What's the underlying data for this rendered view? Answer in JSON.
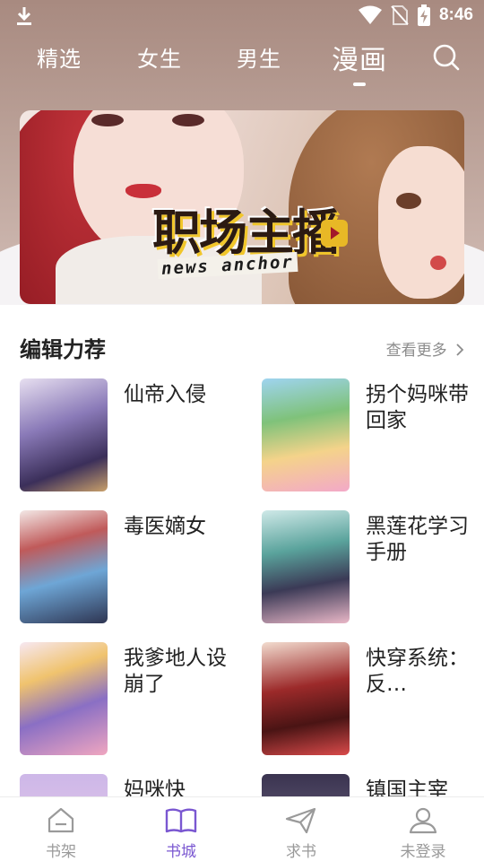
{
  "status_bar": {
    "time": "8:46",
    "icons": [
      "download-icon",
      "wifi-icon",
      "no-sim-icon",
      "battery-charging-icon"
    ]
  },
  "tabs": [
    {
      "label": "精选",
      "active": false
    },
    {
      "label": "女生",
      "active": false
    },
    {
      "label": "男生",
      "active": false
    },
    {
      "label": "漫画",
      "active": true
    }
  ],
  "search_icon": "search-icon",
  "banner": {
    "title_cn": "职场主播",
    "title_en": "news anchor"
  },
  "editor_picks": {
    "title": "编辑力荐",
    "more_label": "查看更多",
    "more_icon": "chevron-right-icon",
    "books": [
      {
        "title": "仙帝入侵"
      },
      {
        "title": "拐个妈咪带回家"
      },
      {
        "title": "毒医嫡女"
      },
      {
        "title": "黑莲花学习手册"
      },
      {
        "title": "我爹地人设崩了"
      },
      {
        "title": "快穿系统：反…"
      },
      {
        "title": "妈咪快"
      },
      {
        "title": "镇国主宰"
      }
    ]
  },
  "bottom_nav": [
    {
      "label": "书架",
      "icon": "bookshelf-icon",
      "active": false
    },
    {
      "label": "书城",
      "icon": "book-open-icon",
      "active": true
    },
    {
      "label": "求书",
      "icon": "paper-plane-icon",
      "active": false
    },
    {
      "label": "未登录",
      "icon": "user-icon",
      "active": false
    }
  ],
  "colors": {
    "accent": "#7a57d1",
    "inactive": "#9a9a9a",
    "header_bg": "#b39a90"
  }
}
